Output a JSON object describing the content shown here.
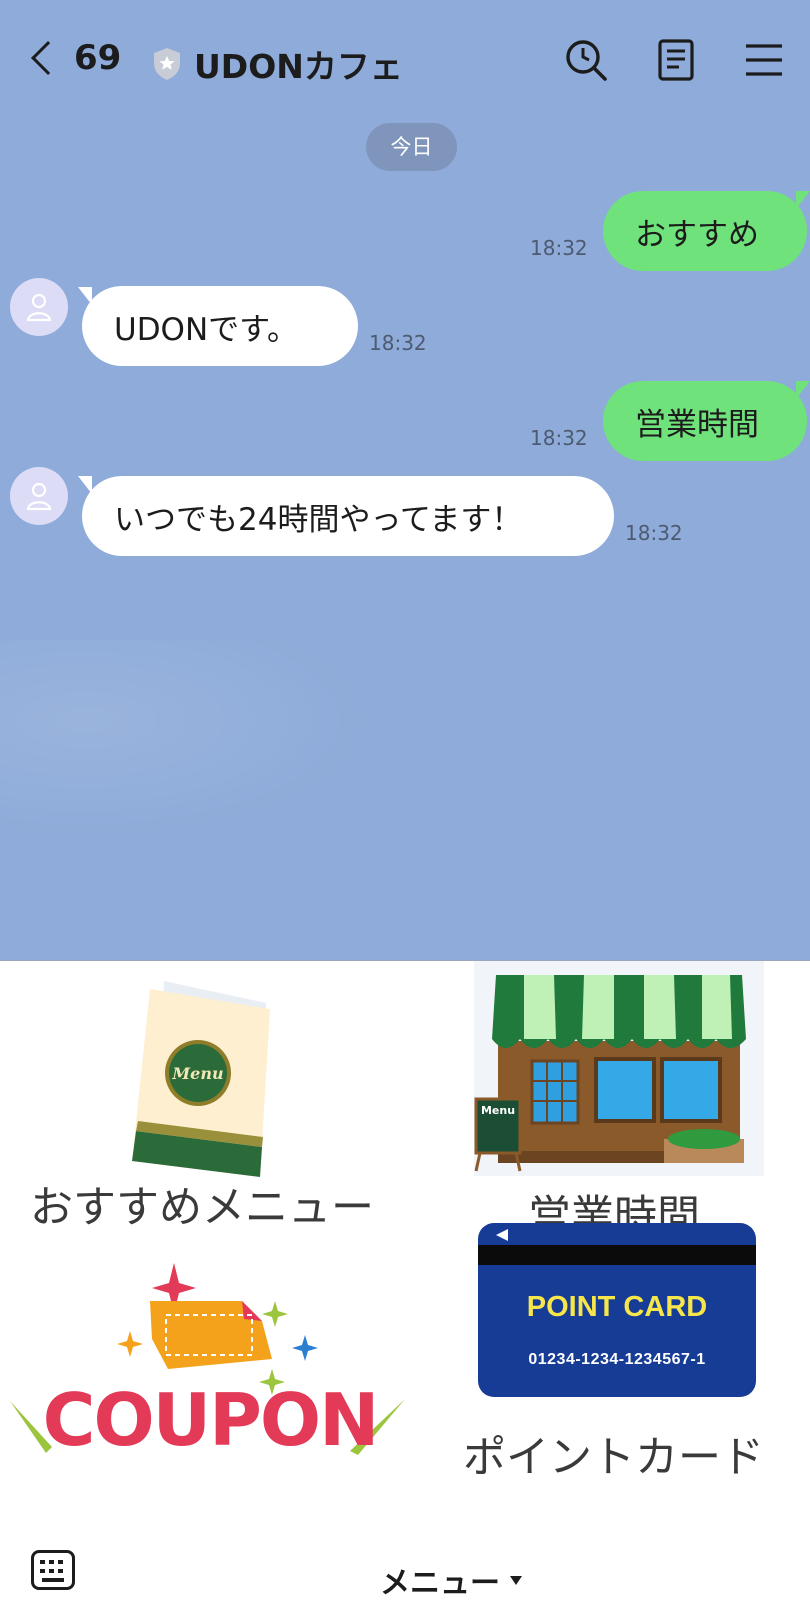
{
  "header": {
    "back_count": "69",
    "title": "UDONカフェ",
    "icons": [
      "search-icon",
      "notes-icon",
      "menu-icon"
    ]
  },
  "chat": {
    "date_label": "今日",
    "messages": [
      {
        "side": "out",
        "text": "おすすめ",
        "time": "18:32"
      },
      {
        "side": "in",
        "text": "UDONです。",
        "time": "18:32"
      },
      {
        "side": "out",
        "text": "営業時間",
        "time": "18:32"
      },
      {
        "side": "in",
        "text": "いつでも24時間やってます！",
        "time": "18:32"
      }
    ]
  },
  "richmenu": {
    "items": [
      {
        "label": "おすすめメニュー",
        "image_text": "Menu"
      },
      {
        "label": "営業時間",
        "image_text": "Menu"
      },
      {
        "label": "",
        "image_text": "COUPON"
      },
      {
        "label": "ポイントカード",
        "image_text": "POINT CARD",
        "card_number": "01234-1234-1234567-1"
      }
    ]
  },
  "bottombar": {
    "menu_label": "メニュー"
  },
  "colors": {
    "chat_background": "#8eabd9",
    "outgoing_bubble": "#6fe27c",
    "incoming_bubble": "#ffffff",
    "date_pill": "#7f95bb",
    "card_blue": "#173c96",
    "card_title": "#f6e64a"
  }
}
